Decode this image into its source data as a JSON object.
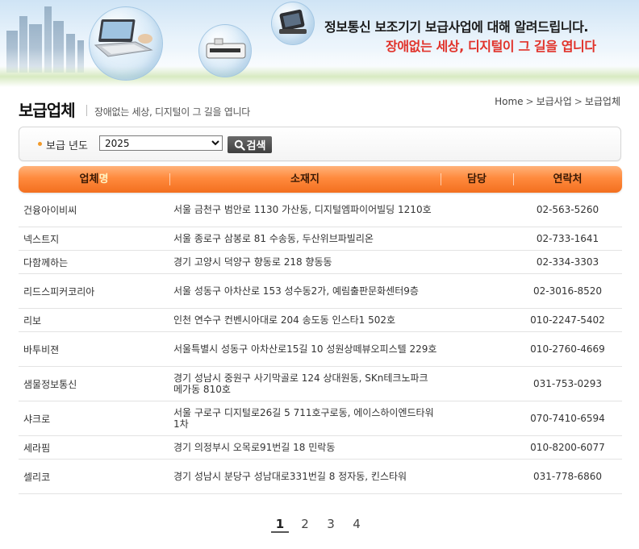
{
  "banner": {
    "message_main": "정보통신 보조기기 보급사업에 대해 알려드립니다.",
    "message_sub": "장애없는 세상, 디지털이 그 길을 엽니다"
  },
  "page": {
    "title": "보급업체",
    "subtitle": "장애없는 세상, 디지털이 그 길을 엽니다"
  },
  "breadcrumb": [
    "Home",
    "보급사업",
    "보급업체"
  ],
  "search": {
    "year_label": "보급 년도",
    "year_value": "2025",
    "button_label": "검색"
  },
  "table": {
    "headers": {
      "name_prefix": "업체",
      "name_suffix": "명",
      "address": "소재지",
      "manager": "담당",
      "contact": "연락처"
    },
    "rows": [
      {
        "name": "건융아이비씨",
        "address": "서울 금천구 범안로 1130   가산동, 디지털엠파이어빌딩 1210호",
        "manager": "",
        "contact": "02-563-5260"
      },
      {
        "name": "넥스트지",
        "address": "서울 종로구 삼봉로 81   수송동, 두산위브파빌리온",
        "manager": "",
        "contact": "02-733-1641"
      },
      {
        "name": "다함께하는",
        "address": "경기 고양시 덕양구 향동로 218   향동동",
        "manager": "",
        "contact": "02-334-3303"
      },
      {
        "name": "리드스피커코리아",
        "address": "서울 성동구 아차산로 153   성수동2가, 예림출판문화센터9층",
        "manager": "",
        "contact": "02-3016-8520"
      },
      {
        "name": "리보",
        "address": "인천 연수구 컨벤시아대로 204   송도동 인스타1 502호",
        "manager": "",
        "contact": "010-2247-5402"
      },
      {
        "name": "바투비젼",
        "address": "서울특별시 성동구 아차산로15길 10   성원상떼뷰오피스텔 229호",
        "manager": "",
        "contact": "010-2760-4669"
      },
      {
        "name": "샘물정보통신",
        "address": "경기 성남시 중원구 사기막골로 124   상대원동, SKn테크노파크 메가동 810호",
        "manager": "",
        "contact": "031-753-0293"
      },
      {
        "name": "샤크로",
        "address": "서울 구로구 디지털로26길 5   711호구로동, 에이스하이엔드타워1차",
        "manager": "",
        "contact": "070-7410-6594"
      },
      {
        "name": "세라핌",
        "address": "경기 의정부시 오목로91번길 18   민락동",
        "manager": "",
        "contact": "010-8200-6077"
      },
      {
        "name": "셀리코",
        "address": "경기 성남시 분당구 성남대로331번길 8   정자동, 킨스타워",
        "manager": "",
        "contact": "031-778-6860"
      }
    ]
  },
  "pagination": {
    "pages": [
      "1",
      "2",
      "3",
      "4"
    ],
    "current": "1"
  },
  "colors": {
    "header_orange": "#f36f1f",
    "accent_red": "#e1322a",
    "bullet_orange": "#f29a2a"
  },
  "icons": {
    "search_button": "magnifier-icon",
    "year_bullet": "dot-icon"
  }
}
